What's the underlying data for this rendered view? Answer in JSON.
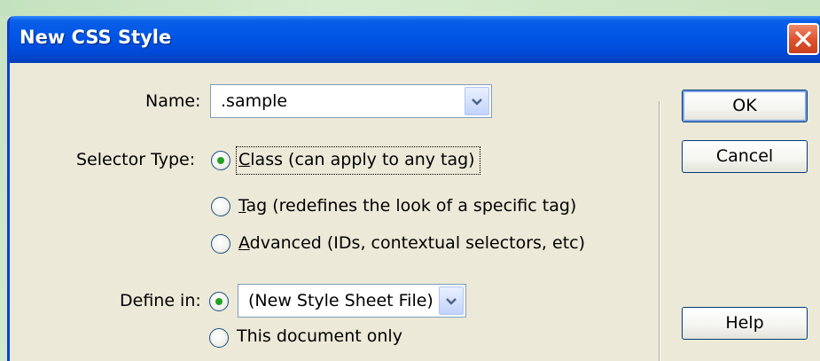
{
  "dialog": {
    "title": "New CSS Style"
  },
  "name_field": {
    "label": "Name:",
    "value": ".sample"
  },
  "selector_type": {
    "label": "Selector Type:",
    "options": [
      {
        "label": "Class (can apply to any tag)",
        "checked": true
      },
      {
        "label": "Tag (redefines the look of a specific tag)",
        "checked": false
      },
      {
        "label": "Advanced (IDs, contextual selectors, etc)",
        "checked": false
      }
    ]
  },
  "define_in": {
    "label": "Define in:",
    "file_option_value": "(New Style Sheet File)",
    "file_option_checked": true,
    "document_option_label": "This document only",
    "document_option_checked": false
  },
  "buttons": {
    "ok": "OK",
    "cancel": "Cancel",
    "help": "Help"
  },
  "colors": {
    "titlebar": "#0055e5",
    "dialog_bg": "#ece9d8",
    "close_button": "#e0532f",
    "radio_dot": "#21a121"
  }
}
